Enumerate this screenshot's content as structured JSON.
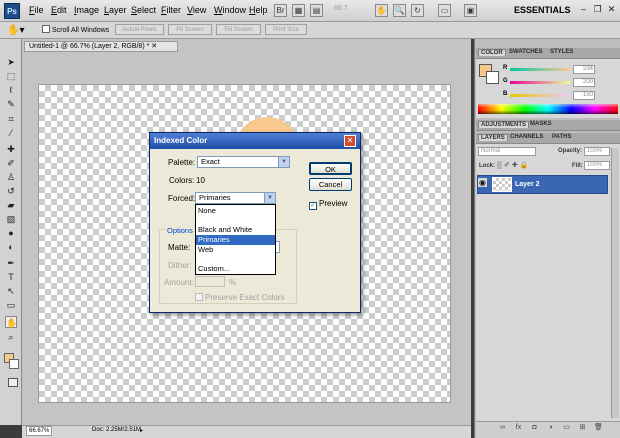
{
  "menubar": {
    "logo": "Ps",
    "items": [
      "File",
      "Edit",
      "Image",
      "Layer",
      "Select",
      "Filter",
      "View",
      "Window",
      "Help"
    ],
    "workspace": "ESSENTIALS",
    "zoom_menu": "66.7"
  },
  "optionsbar": {
    "scroll_all": "Scroll All Windows",
    "buttons": [
      "Actual Pixels",
      "Fit Screen",
      "Fill Screen",
      "Print Size"
    ]
  },
  "document": {
    "tab": "Untitled-1 @ 66.7% (Layer 2, RGB/8) *",
    "zoom": "66.67%",
    "info": "Doc: 2.25M/2.51M"
  },
  "color_panel": {
    "tabs": [
      "COLOR",
      "SWATCHES",
      "STYLES"
    ],
    "channels": [
      "R",
      "G",
      "B"
    ],
    "values": [
      "234",
      "200",
      "150"
    ],
    "fg_color": "#f4c98c"
  },
  "adjust_panel": {
    "tabs": [
      "ADJUSTMENTS",
      "MASKS"
    ]
  },
  "layers_panel": {
    "tabs": [
      "LAYERS",
      "CHANNELS",
      "PATHS"
    ],
    "blend_mode": "Normal",
    "opacity_label": "Opacity:",
    "opacity": "100%",
    "lock_label": "Lock:",
    "fill_label": "Fill:",
    "fill": "100%",
    "layer_name": "Layer 2"
  },
  "dialog": {
    "title": "Indexed Color",
    "palette_label": "Palette:",
    "palette_value": "Exact",
    "colors_label": "Colors:",
    "colors_value": "10",
    "forced_label": "Forced:",
    "forced_value": "Primaries",
    "options_label": "Options",
    "matte_label": "Matte:",
    "dither_label": "Dither:",
    "amount_label": "Amount:",
    "amount_unit": "%",
    "preserve_label": "Preserve Exact Colors",
    "ok": "OK",
    "cancel": "Cancel",
    "preview": "Preview",
    "preview_checked": true,
    "dropdown_items": [
      "None",
      "Black and White",
      "Primaries",
      "Web",
      "Custom..."
    ],
    "dropdown_selected": "Primaries"
  }
}
